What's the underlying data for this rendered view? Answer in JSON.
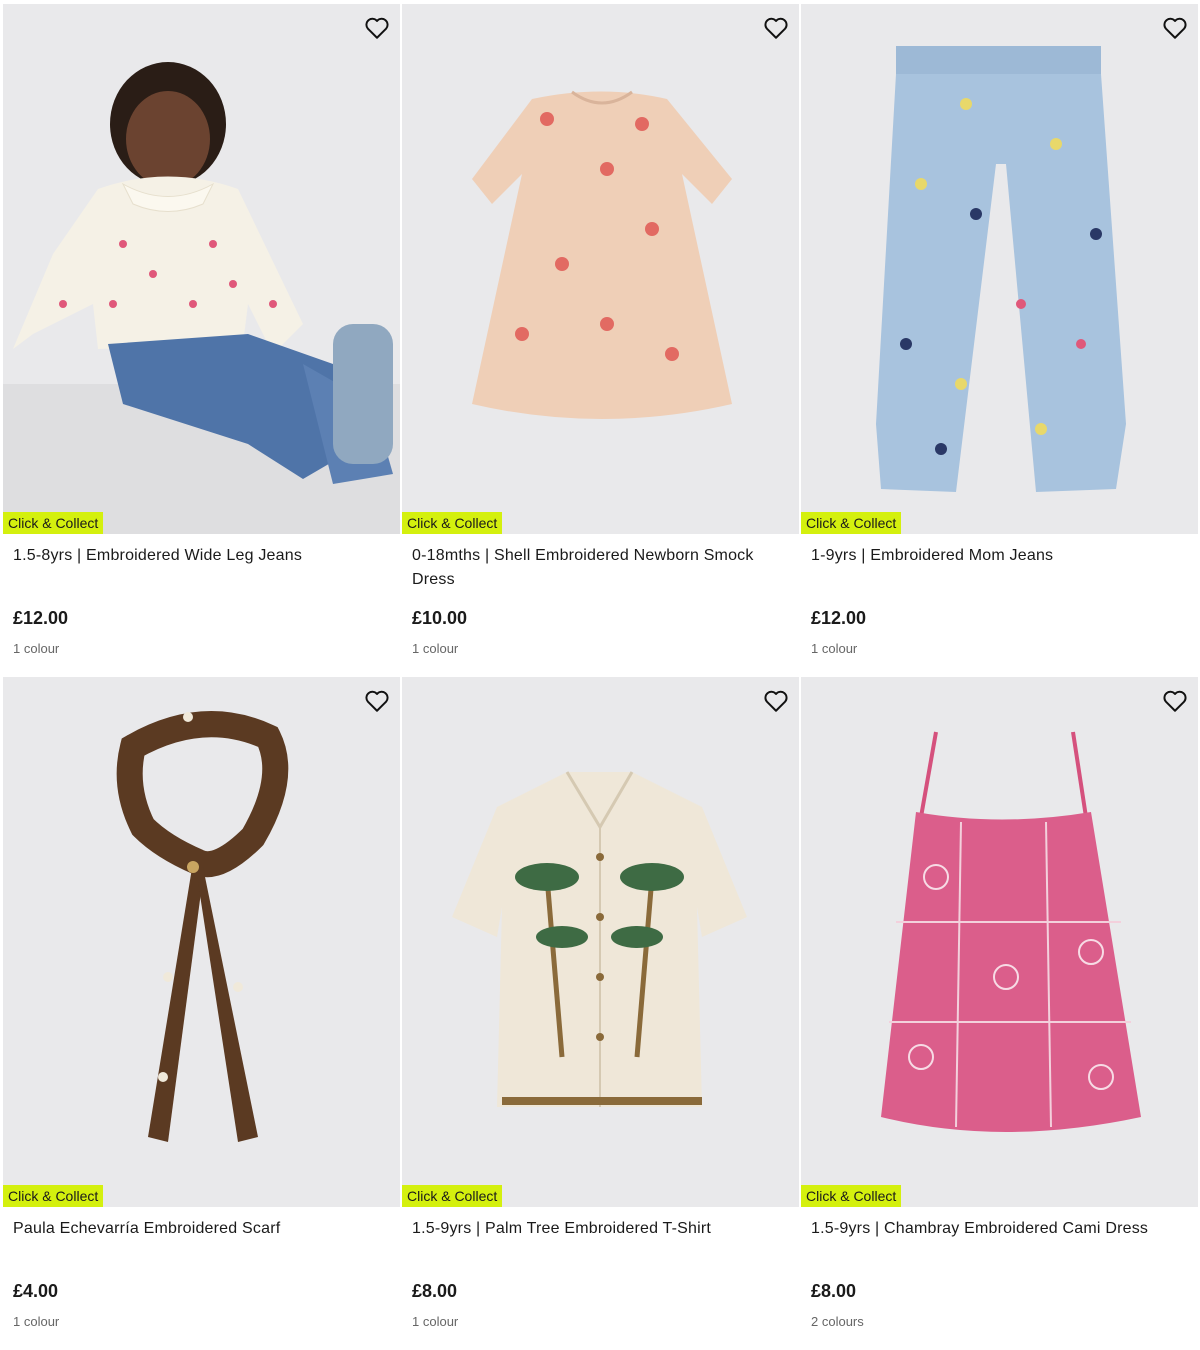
{
  "badge_label": "Click & Collect",
  "products": [
    {
      "title": "1.5-8yrs | Embroidered Wide Leg Jeans",
      "price": "£12.00",
      "colours": "1 colour",
      "image": "girl-in-embroidered-wide-leg-jeans"
    },
    {
      "title": "0-18mths | Shell Embroidered Newborn Smock Dress",
      "price": "£10.00",
      "colours": "1 colour",
      "image": "peach-smock-dress"
    },
    {
      "title": "1-9yrs | Embroidered Mom Jeans",
      "price": "£12.00",
      "colours": "1 colour",
      "image": "light-blue-mom-jeans"
    },
    {
      "title": "Paula Echevarría Embroidered Scarf",
      "price": "£4.00",
      "colours": "1 colour",
      "image": "brown-embroidered-scarf"
    },
    {
      "title": "1.5-9yrs | Palm Tree Embroidered T-Shirt",
      "price": "£8.00",
      "colours": "1 colour",
      "image": "palm-tree-shirt"
    },
    {
      "title": "1.5-9yrs | Chambray Embroidered Cami Dress",
      "price": "£8.00",
      "colours": "2 colours",
      "image": "pink-cami-dress"
    }
  ],
  "colors": {
    "badge": "#d4f00e",
    "image_bg": "#ebebed",
    "text": "#1a1a1a",
    "muted": "#666666"
  }
}
